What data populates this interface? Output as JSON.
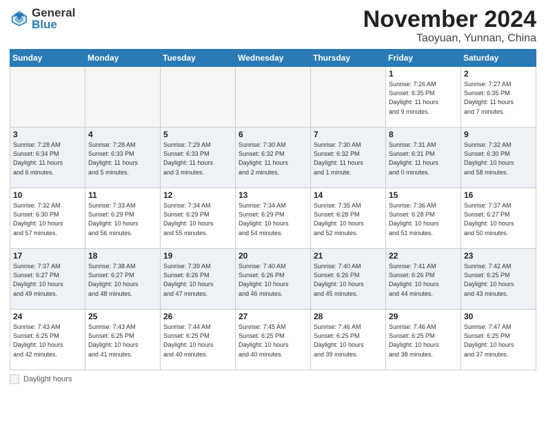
{
  "logo": {
    "general": "General",
    "blue": "Blue"
  },
  "header": {
    "month": "November 2024",
    "location": "Taoyuan, Yunnan, China"
  },
  "days_of_week": [
    "Sunday",
    "Monday",
    "Tuesday",
    "Wednesday",
    "Thursday",
    "Friday",
    "Saturday"
  ],
  "footer": {
    "label": "Daylight hours"
  },
  "weeks": [
    [
      {
        "day": "",
        "info": ""
      },
      {
        "day": "",
        "info": ""
      },
      {
        "day": "",
        "info": ""
      },
      {
        "day": "",
        "info": ""
      },
      {
        "day": "",
        "info": ""
      },
      {
        "day": "1",
        "info": "Sunrise: 7:26 AM\nSunset: 6:35 PM\nDaylight: 11 hours\nand 9 minutes."
      },
      {
        "day": "2",
        "info": "Sunrise: 7:27 AM\nSunset: 6:35 PM\nDaylight: 11 hours\nand 7 minutes."
      }
    ],
    [
      {
        "day": "3",
        "info": "Sunrise: 7:28 AM\nSunset: 6:34 PM\nDaylight: 11 hours\nand 6 minutes."
      },
      {
        "day": "4",
        "info": "Sunrise: 7:28 AM\nSunset: 6:33 PM\nDaylight: 11 hours\nand 5 minutes."
      },
      {
        "day": "5",
        "info": "Sunrise: 7:29 AM\nSunset: 6:33 PM\nDaylight: 11 hours\nand 3 minutes."
      },
      {
        "day": "6",
        "info": "Sunrise: 7:30 AM\nSunset: 6:32 PM\nDaylight: 11 hours\nand 2 minutes."
      },
      {
        "day": "7",
        "info": "Sunrise: 7:30 AM\nSunset: 6:32 PM\nDaylight: 11 hours\nand 1 minute."
      },
      {
        "day": "8",
        "info": "Sunrise: 7:31 AM\nSunset: 6:31 PM\nDaylight: 11 hours\nand 0 minutes."
      },
      {
        "day": "9",
        "info": "Sunrise: 7:32 AM\nSunset: 6:30 PM\nDaylight: 10 hours\nand 58 minutes."
      }
    ],
    [
      {
        "day": "10",
        "info": "Sunrise: 7:32 AM\nSunset: 6:30 PM\nDaylight: 10 hours\nand 57 minutes."
      },
      {
        "day": "11",
        "info": "Sunrise: 7:33 AM\nSunset: 6:29 PM\nDaylight: 10 hours\nand 56 minutes."
      },
      {
        "day": "12",
        "info": "Sunrise: 7:34 AM\nSunset: 6:29 PM\nDaylight: 10 hours\nand 55 minutes."
      },
      {
        "day": "13",
        "info": "Sunrise: 7:34 AM\nSunset: 6:29 PM\nDaylight: 10 hours\nand 54 minutes."
      },
      {
        "day": "14",
        "info": "Sunrise: 7:35 AM\nSunset: 6:28 PM\nDaylight: 10 hours\nand 52 minutes."
      },
      {
        "day": "15",
        "info": "Sunrise: 7:36 AM\nSunset: 6:28 PM\nDaylight: 10 hours\nand 51 minutes."
      },
      {
        "day": "16",
        "info": "Sunrise: 7:37 AM\nSunset: 6:27 PM\nDaylight: 10 hours\nand 50 minutes."
      }
    ],
    [
      {
        "day": "17",
        "info": "Sunrise: 7:37 AM\nSunset: 6:27 PM\nDaylight: 10 hours\nand 49 minutes."
      },
      {
        "day": "18",
        "info": "Sunrise: 7:38 AM\nSunset: 6:27 PM\nDaylight: 10 hours\nand 48 minutes."
      },
      {
        "day": "19",
        "info": "Sunrise: 7:39 AM\nSunset: 6:26 PM\nDaylight: 10 hours\nand 47 minutes."
      },
      {
        "day": "20",
        "info": "Sunrise: 7:40 AM\nSunset: 6:26 PM\nDaylight: 10 hours\nand 46 minutes."
      },
      {
        "day": "21",
        "info": "Sunrise: 7:40 AM\nSunset: 6:26 PM\nDaylight: 10 hours\nand 45 minutes."
      },
      {
        "day": "22",
        "info": "Sunrise: 7:41 AM\nSunset: 6:26 PM\nDaylight: 10 hours\nand 44 minutes."
      },
      {
        "day": "23",
        "info": "Sunrise: 7:42 AM\nSunset: 6:25 PM\nDaylight: 10 hours\nand 43 minutes."
      }
    ],
    [
      {
        "day": "24",
        "info": "Sunrise: 7:43 AM\nSunset: 6:25 PM\nDaylight: 10 hours\nand 42 minutes."
      },
      {
        "day": "25",
        "info": "Sunrise: 7:43 AM\nSunset: 6:25 PM\nDaylight: 10 hours\nand 41 minutes."
      },
      {
        "day": "26",
        "info": "Sunrise: 7:44 AM\nSunset: 6:25 PM\nDaylight: 10 hours\nand 40 minutes."
      },
      {
        "day": "27",
        "info": "Sunrise: 7:45 AM\nSunset: 6:25 PM\nDaylight: 10 hours\nand 40 minutes."
      },
      {
        "day": "28",
        "info": "Sunrise: 7:46 AM\nSunset: 6:25 PM\nDaylight: 10 hours\nand 39 minutes."
      },
      {
        "day": "29",
        "info": "Sunrise: 7:46 AM\nSunset: 6:25 PM\nDaylight: 10 hours\nand 38 minutes."
      },
      {
        "day": "30",
        "info": "Sunrise: 7:47 AM\nSunset: 6:25 PM\nDaylight: 10 hours\nand 37 minutes."
      }
    ]
  ]
}
